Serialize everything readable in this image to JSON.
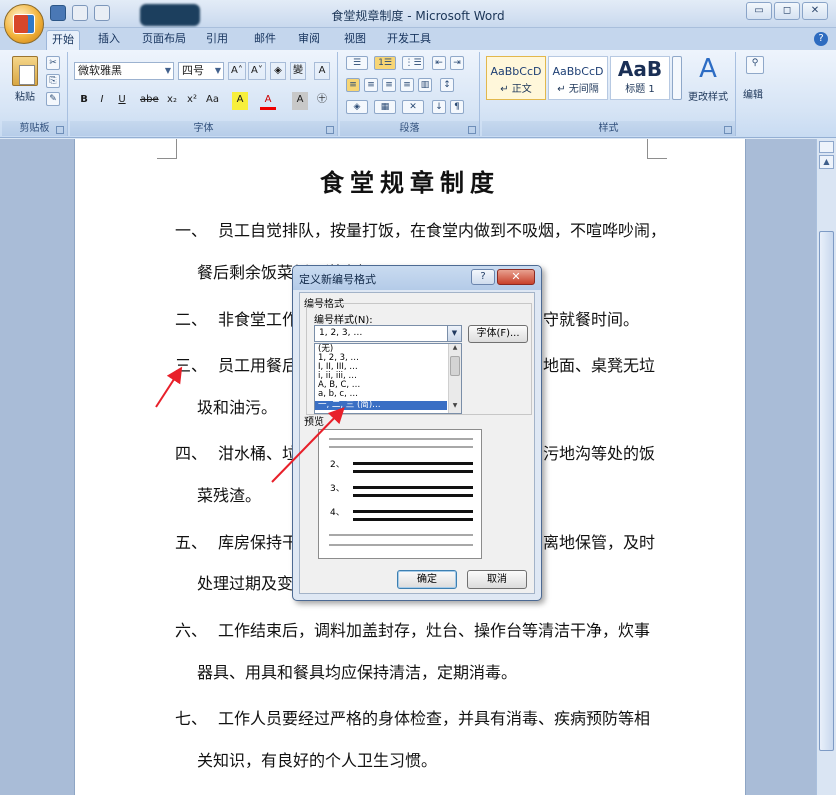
{
  "window": {
    "title": "食堂规章制度 - Microsoft Word",
    "controls": [
      "▭",
      "◻",
      "✕"
    ]
  },
  "tabs": [
    {
      "label": "开始",
      "active": true
    },
    {
      "label": "插入"
    },
    {
      "label": "页面布局"
    },
    {
      "label": "引用"
    },
    {
      "label": "邮件"
    },
    {
      "label": "审阅"
    },
    {
      "label": "视图"
    },
    {
      "label": "开发工具"
    }
  ],
  "ribbon": {
    "clipboard": {
      "paste": "粘贴",
      "label": "剪贴板"
    },
    "font": {
      "name": "微软雅黑",
      "size": "四号",
      "label": "字体",
      "buttons": [
        "B",
        "I",
        "U",
        "abe",
        "x₂",
        "x²",
        "Aa",
        "A",
        "A",
        "㊉"
      ]
    },
    "paragraph": {
      "label": "段落"
    },
    "styles": {
      "label": "样式",
      "items": [
        {
          "sample": "AaBbCcD",
          "name": "↵ 正文"
        },
        {
          "sample": "AaBbCcD",
          "name": "↵ 无间隔"
        },
        {
          "sample": "AaB",
          "name": "标题 1"
        }
      ],
      "change_styles": "更改样式"
    },
    "editing": {
      "label": "编辑"
    }
  },
  "document": {
    "title": "食堂规章制度",
    "paragraphs": [
      {
        "num": "一、",
        "lines": [
          "员工自觉排队，按量打饭，在食堂内做到不吸烟，不喧哗吵闹，",
          "餐后剩余饭菜倒入泔水桶。"
        ]
      },
      {
        "num": "二、",
        "lines": [
          "非食堂工作",
          "守就餐时间。"
        ]
      },
      {
        "num": "三、",
        "lines": [
          "员工用餐后",
          "地面、桌凳无垃",
          "圾和油污。"
        ]
      },
      {
        "num": "四、",
        "lines": [
          "泔水桶、垃",
          "污地沟等处的饭",
          "菜残渣。"
        ]
      },
      {
        "num": "五、",
        "lines": [
          "库房保持干",
          "离地保管，及时",
          "处理过期及变"
        ]
      },
      {
        "num": "六、",
        "lines": [
          "工作结束后，调料加盖封存，灶台、操作台等清洁干净，炊事",
          "器具、用具和餐具均应保持清洁，定期消毒。"
        ]
      },
      {
        "num": "七、",
        "lines": [
          "工作人员要经过严格的身体检查，并具有消毒、疾病预防等相",
          "关知识，有良好的个人卫生习惯。"
        ]
      }
    ]
  },
  "dialog": {
    "title": "定义新编号格式",
    "help": "?",
    "close": "✕",
    "group_label": "编号格式",
    "style_label": "编号样式(N):",
    "style_value": "1, 2, 3, …",
    "font_button": "字体(F)...",
    "list_options": [
      "(无)",
      "1, 2, 3, …",
      "I, II, III, …",
      "i, ii, iii, …",
      "A, B, C, …",
      "a, b, c, …",
      "一, 二, 三 (简)…"
    ],
    "selected_index": 6,
    "preview_label": "预览",
    "preview_numbers": [
      "2、",
      "3、",
      "4、"
    ],
    "ok": "确定",
    "cancel": "取消"
  }
}
